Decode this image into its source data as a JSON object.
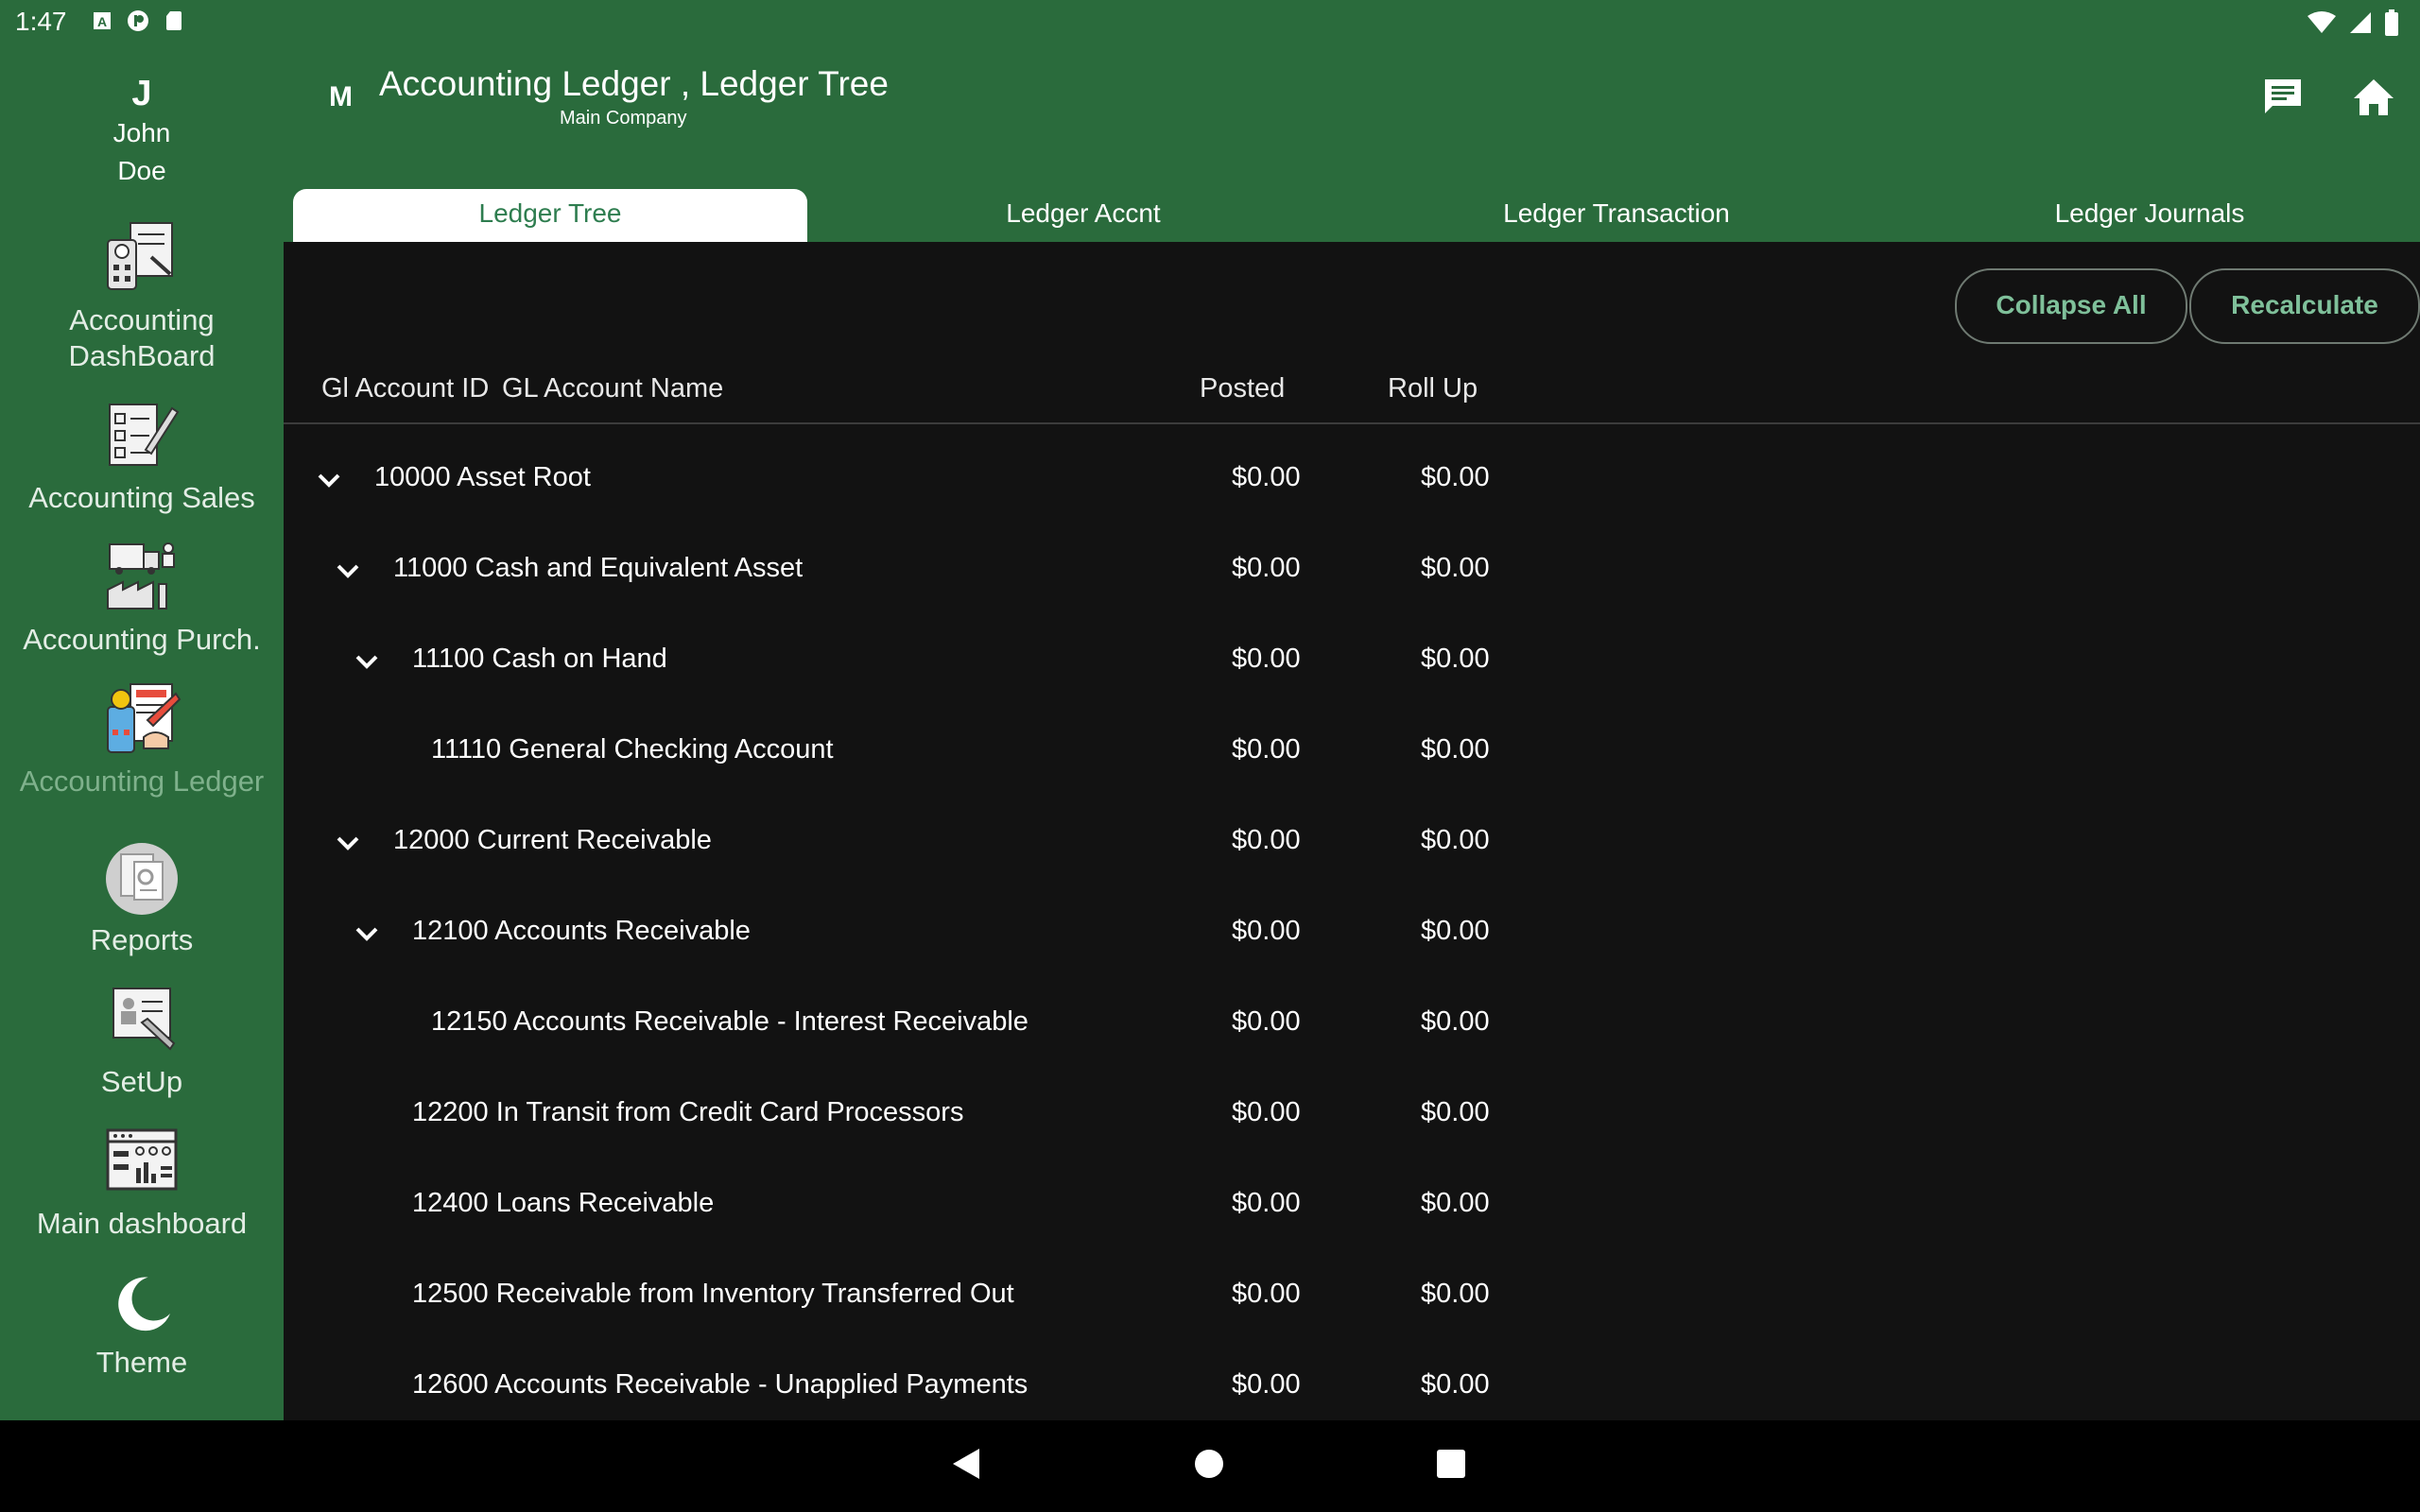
{
  "status_bar": {
    "time": "1:47",
    "left_icons": [
      "a-icon",
      "cast-icon",
      "sd-card-icon"
    ],
    "right_icons": [
      "wifi-icon",
      "signal-icon",
      "battery-icon"
    ]
  },
  "user": {
    "initial": "J",
    "first_name": "John",
    "last_name": "Doe"
  },
  "sidebar": {
    "items": [
      {
        "line1": "Accounting",
        "line2": "DashBoard",
        "icon": "accounting-dashboard-icon"
      },
      {
        "line1": "Accounting Sales",
        "icon": "accounting-sales-icon"
      },
      {
        "line1": "Accounting Purch.",
        "icon": "accounting-purchase-icon"
      },
      {
        "line1": "Accounting Ledger",
        "icon": "accounting-ledger-icon",
        "active": true
      },
      {
        "line1": "Reports",
        "icon": "reports-icon"
      },
      {
        "line1": "SetUp",
        "icon": "setup-icon"
      },
      {
        "line1": "Main dashboard",
        "icon": "main-dashboard-icon"
      },
      {
        "line1": "Theme",
        "icon": "moon-icon"
      }
    ]
  },
  "header": {
    "company_initial": "M",
    "title": "Accounting Ledger , Ledger Tree",
    "subtitle": "Main Company",
    "actions": [
      "chat-icon",
      "home-icon"
    ]
  },
  "tabs": [
    {
      "label": "Ledger Tree",
      "active": true
    },
    {
      "label": "Ledger Accnt"
    },
    {
      "label": "Ledger Transaction"
    },
    {
      "label": "Ledger Journals"
    }
  ],
  "buttons": {
    "collapse_all": "Collapse All",
    "recalculate": "Recalculate"
  },
  "table": {
    "columns": {
      "id": "Gl Account ID",
      "name": "GL Account Name",
      "posted": "Posted",
      "rollup": "Roll Up"
    },
    "rows": [
      {
        "label": "10000 Asset Root",
        "level": 0,
        "expanded": true,
        "posted": "$0.00",
        "rollup": "$0.00"
      },
      {
        "label": "11000 Cash and Equivalent Asset",
        "level": 1,
        "expanded": true,
        "posted": "$0.00",
        "rollup": "$0.00"
      },
      {
        "label": "11100 Cash on Hand",
        "level": 2,
        "expanded": true,
        "posted": "$0.00",
        "rollup": "$0.00"
      },
      {
        "label": "11110 General Checking Account",
        "level": 3,
        "expanded": false,
        "posted": "$0.00",
        "rollup": "$0.00"
      },
      {
        "label": "12000 Current Receivable",
        "level": 1,
        "expanded": true,
        "posted": "$0.00",
        "rollup": "$0.00"
      },
      {
        "label": "12100 Accounts Receivable",
        "level": 2,
        "expanded": true,
        "posted": "$0.00",
        "rollup": "$0.00"
      },
      {
        "label": "12150 Accounts Receivable - Interest Receivable",
        "level": 3,
        "expanded": false,
        "posted": "$0.00",
        "rollup": "$0.00"
      },
      {
        "label": "12200 In Transit from Credit Card Processors",
        "level": 2,
        "expanded": false,
        "posted": "$0.00",
        "rollup": "$0.00"
      },
      {
        "label": "12400 Loans Receivable",
        "level": 2,
        "expanded": false,
        "posted": "$0.00",
        "rollup": "$0.00"
      },
      {
        "label": "12500 Receivable from Inventory Transferred Out",
        "level": 2,
        "expanded": false,
        "posted": "$0.00",
        "rollup": "$0.00"
      },
      {
        "label": "12600 Accounts Receivable - Unapplied Payments",
        "level": 2,
        "expanded": false,
        "posted": "$0.00",
        "rollup": "$0.00"
      }
    ]
  },
  "nav_bar": [
    "back-icon",
    "home-circle-icon",
    "recents-icon"
  ],
  "colors": {
    "primary_green": "#2a6b3c",
    "background": "#121212",
    "accent": "#7fc09a",
    "active_tab_text": "#2e7d4f"
  }
}
